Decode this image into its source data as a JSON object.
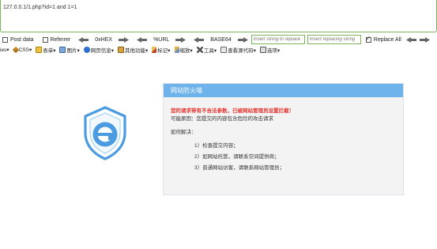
{
  "url_bar": {
    "text": "127.0.0.1/1.php?id=1 and 1=1"
  },
  "hackbar": {
    "post_data_label": "Post data",
    "post_data_checked": false,
    "referrer_label": "Referrer",
    "referrer_checked": false,
    "hex_label": "0xHEX",
    "url_label": "%URL",
    "base64_label": "BASE64",
    "insert_string_placeholder": "Insert string to replace",
    "insert_replacing_placeholder": "Insert replacing string",
    "replace_all_label": "Replace All",
    "replace_all_checked": true
  },
  "toolbar": {
    "items": [
      {
        "label": "ies▾",
        "icon": "none"
      },
      {
        "label": "CSS▾",
        "icon": "css-icon"
      },
      {
        "label": "表单▾",
        "icon": "form-icon"
      },
      {
        "label": "图片▾",
        "icon": "image-icon"
      },
      {
        "label": "网页信息▾",
        "icon": "info-icon"
      },
      {
        "label": "其他功能▾",
        "icon": "misc-icon"
      },
      {
        "label": "标记▾",
        "icon": "mark-icon"
      },
      {
        "label": "缩放▾",
        "icon": "zoom-icon"
      },
      {
        "label": "工具▾",
        "icon": "tools-icon"
      },
      {
        "label": "查看源代码▾",
        "icon": "source-icon"
      },
      {
        "label": "选项▾",
        "icon": "options-icon"
      }
    ]
  },
  "firewall": {
    "title": "网站防火墙",
    "warning": "您的请求带有不合法参数，已被网站管理员设置拦截！",
    "reason": "可能原因：您提交的内容包含危险的攻击请求",
    "how_to": "如何解决：",
    "steps": [
      "1）检查提交内容；",
      "2）如网站托管，请联系空间提供商；",
      "3）普通网站访客，请联系网站管理员；"
    ],
    "colors": {
      "header": "#6fb3ec",
      "warning": "#e5322d",
      "logo": "#4a9be0"
    }
  }
}
